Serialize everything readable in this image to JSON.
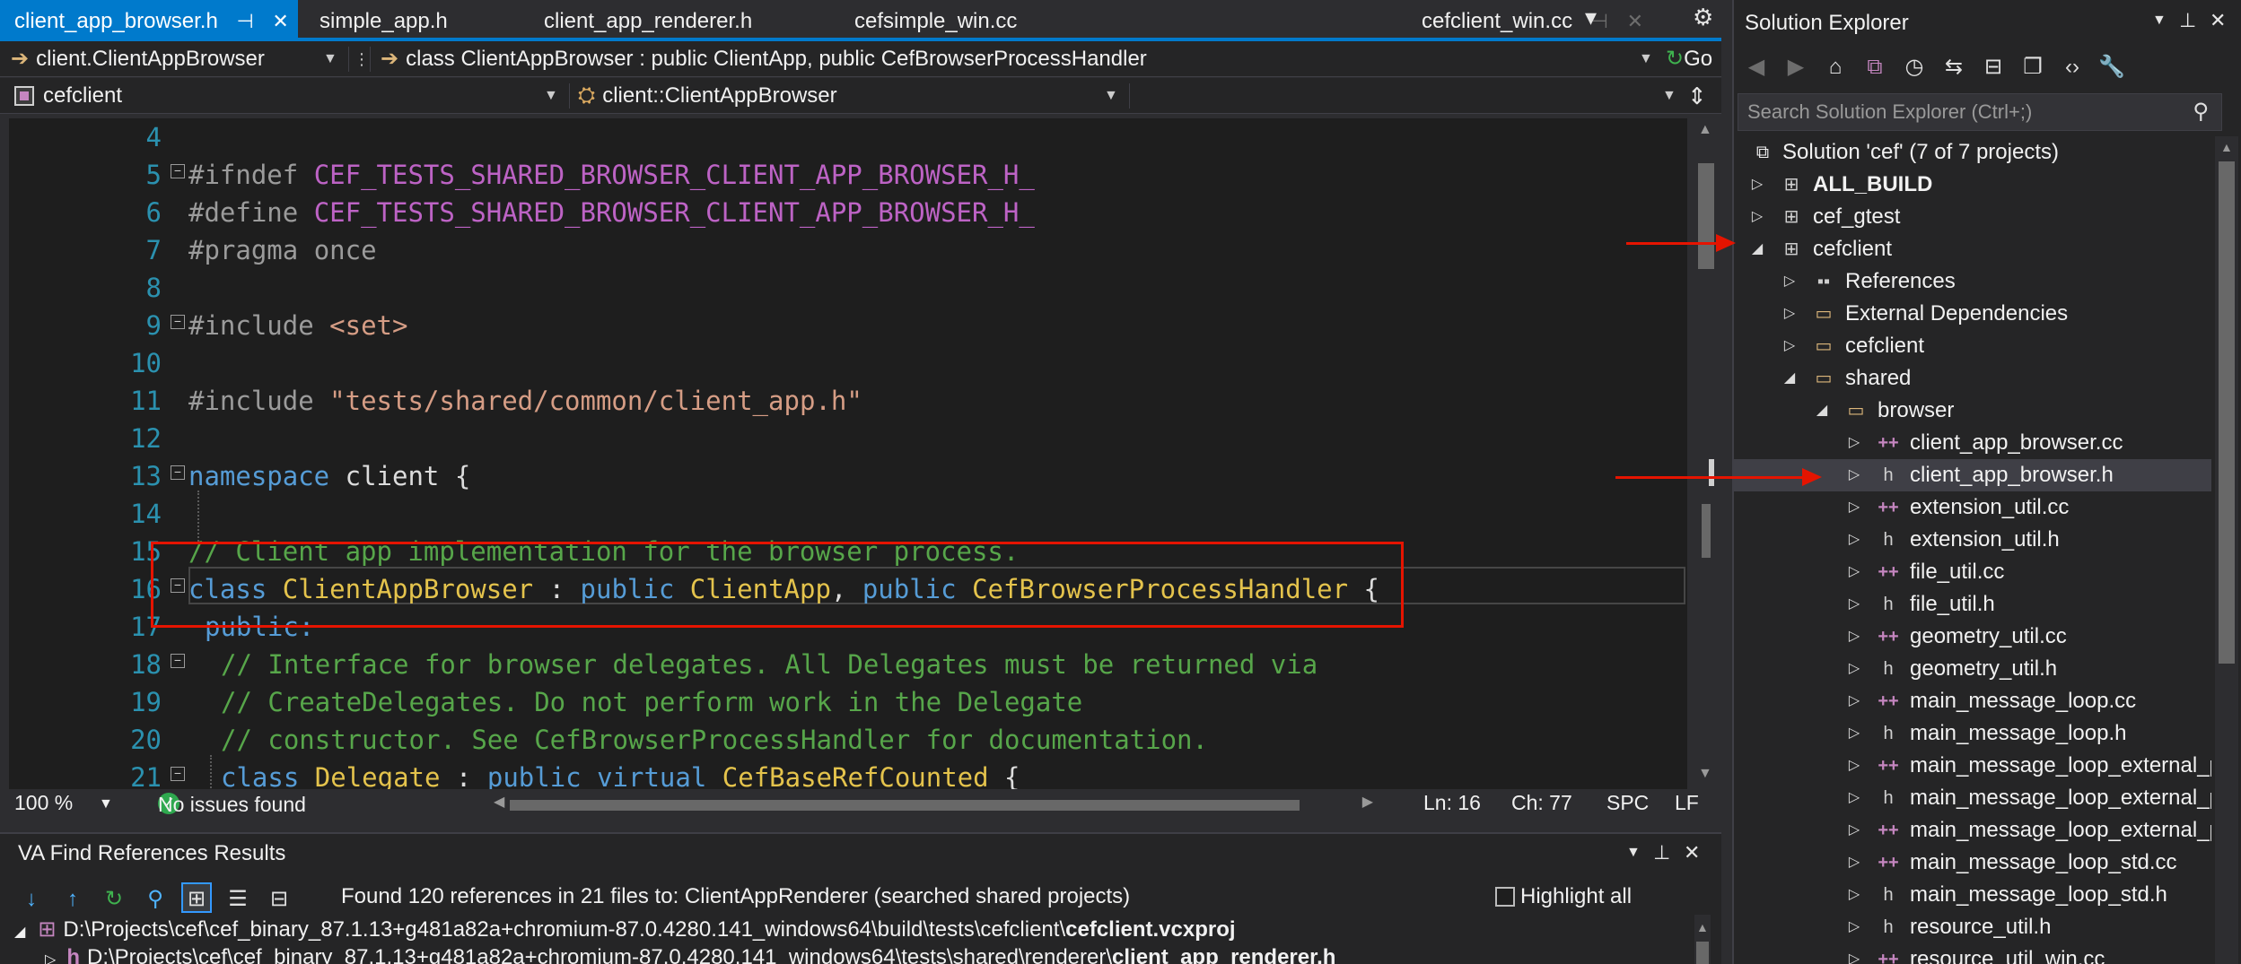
{
  "tabs": [
    {
      "label": "client_app_browser.h",
      "active": true
    },
    {
      "label": "simple_app.h"
    },
    {
      "label": "client_app_renderer.h"
    },
    {
      "label": "cefsimple_win.cc"
    },
    {
      "label": "cefclient_win.cc"
    }
  ],
  "nav": {
    "scope": "client.ClientAppBrowser",
    "definition": "class ClientAppBrowser : public ClientApp, public CefBrowserProcessHandler",
    "go_label": "Go",
    "project": "cefclient",
    "member": "client::ClientAppBrowser",
    "empty": ""
  },
  "code": {
    "line_numbers": [
      "4",
      "5",
      "6",
      "7",
      "8",
      "9",
      "10",
      "11",
      "12",
      "13",
      "14",
      "15",
      "16",
      "17",
      "18",
      "19",
      "20",
      "21"
    ],
    "l5_directive": "#ifndef",
    "l5_macro": "CEF_TESTS_SHARED_BROWSER_CLIENT_APP_BROWSER_H_",
    "l6_directive": "#define",
    "l6_macro": "CEF_TESTS_SHARED_BROWSER_CLIENT_APP_BROWSER_H_",
    "l7_directive": "#pragma",
    "l7_rest": "once",
    "l9_directive": "#include",
    "l9_file": "<set>",
    "l11_directive": "#include",
    "l11_file": "\"tests/shared/common/client_app.h\"",
    "l13_kw": "namespace",
    "l13_name": "client {",
    "l15_comment": "// Client app implementation for the browser process.",
    "l16_kw": "class",
    "l16_name": "ClientAppBrowser",
    "l16_colon": " : ",
    "l16_pub1": "public",
    "l16_base1": "ClientApp",
    "l16_comma": ", ",
    "l16_pub2": "public",
    "l16_base2": "CefBrowserProcessHandler",
    "l16_brace": " {",
    "l17_kw": "public:",
    "l18_comment": "// Interface for browser delegates. All Delegates must be returned via",
    "l19_comment": "// CreateDelegates. Do not perform work in the Delegate",
    "l20_comment": "// constructor. See CefBrowserProcessHandler for documentation.",
    "l21_kw": "class",
    "l21_name": "Delegate",
    "l21_colon": " : ",
    "l21_pub": "public",
    "l21_virt": "virtual",
    "l21_base": "CefBaseRefCounted",
    "l21_brace": " {"
  },
  "status": {
    "zoom": "100 %",
    "issues": "No issues found",
    "line": "Ln: 16",
    "col": "Ch: 77",
    "spacing": "SPC",
    "eol": "LF"
  },
  "va": {
    "title": "VA Find References Results",
    "found": "Found 120 references in 21 files to: ClientAppRenderer (searched shared projects)",
    "highlight_all": "Highlight all",
    "path1_prefix": "D:\\Projects\\cef\\cef_binary_87.1.13+g481a82a+chromium-87.0.4280.141_windows64\\build\\tests\\cefclient\\",
    "path1_file": "cefclient.vcxproj",
    "path2_prefix": "D:\\Projects\\cef\\cef_binary_87.1.13+g481a82a+chromium-87.0.4280.141_windows64\\tests\\shared\\renderer\\",
    "path2_file": "client_app_renderer.h"
  },
  "solution_explorer": {
    "title": "Solution Explorer",
    "search_placeholder": "Search Solution Explorer (Ctrl+;)",
    "items": [
      {
        "label": "Solution 'cef' (7 of 7 projects)"
      },
      {
        "label": "ALL_BUILD"
      },
      {
        "label": "cef_gtest"
      },
      {
        "label": "cefclient"
      },
      {
        "label": "References"
      },
      {
        "label": "External Dependencies"
      },
      {
        "label": "cefclient"
      },
      {
        "label": "shared"
      },
      {
        "label": "browser"
      },
      {
        "label": "client_app_browser.cc"
      },
      {
        "label": "client_app_browser.h"
      },
      {
        "label": "extension_util.cc"
      },
      {
        "label": "extension_util.h"
      },
      {
        "label": "file_util.cc"
      },
      {
        "label": "file_util.h"
      },
      {
        "label": "geometry_util.cc"
      },
      {
        "label": "geometry_util.h"
      },
      {
        "label": "main_message_loop.cc"
      },
      {
        "label": "main_message_loop.h"
      },
      {
        "label": "main_message_loop_external_pump.cc"
      },
      {
        "label": "main_message_loop_external_pump.h"
      },
      {
        "label": "main_message_loop_external_pump_win.cc"
      },
      {
        "label": "main_message_loop_std.cc"
      },
      {
        "label": "main_message_loop_std.h"
      },
      {
        "label": "resource_util.h"
      },
      {
        "label": "resource_util_win.cc"
      }
    ]
  },
  "colors": {
    "accent": "#007acc",
    "annotation": "#e51400",
    "keyword": "#569cd6",
    "macro": "#bd63c5",
    "string": "#d69d85",
    "comment": "#57a64a",
    "type": "#e4c34c"
  }
}
